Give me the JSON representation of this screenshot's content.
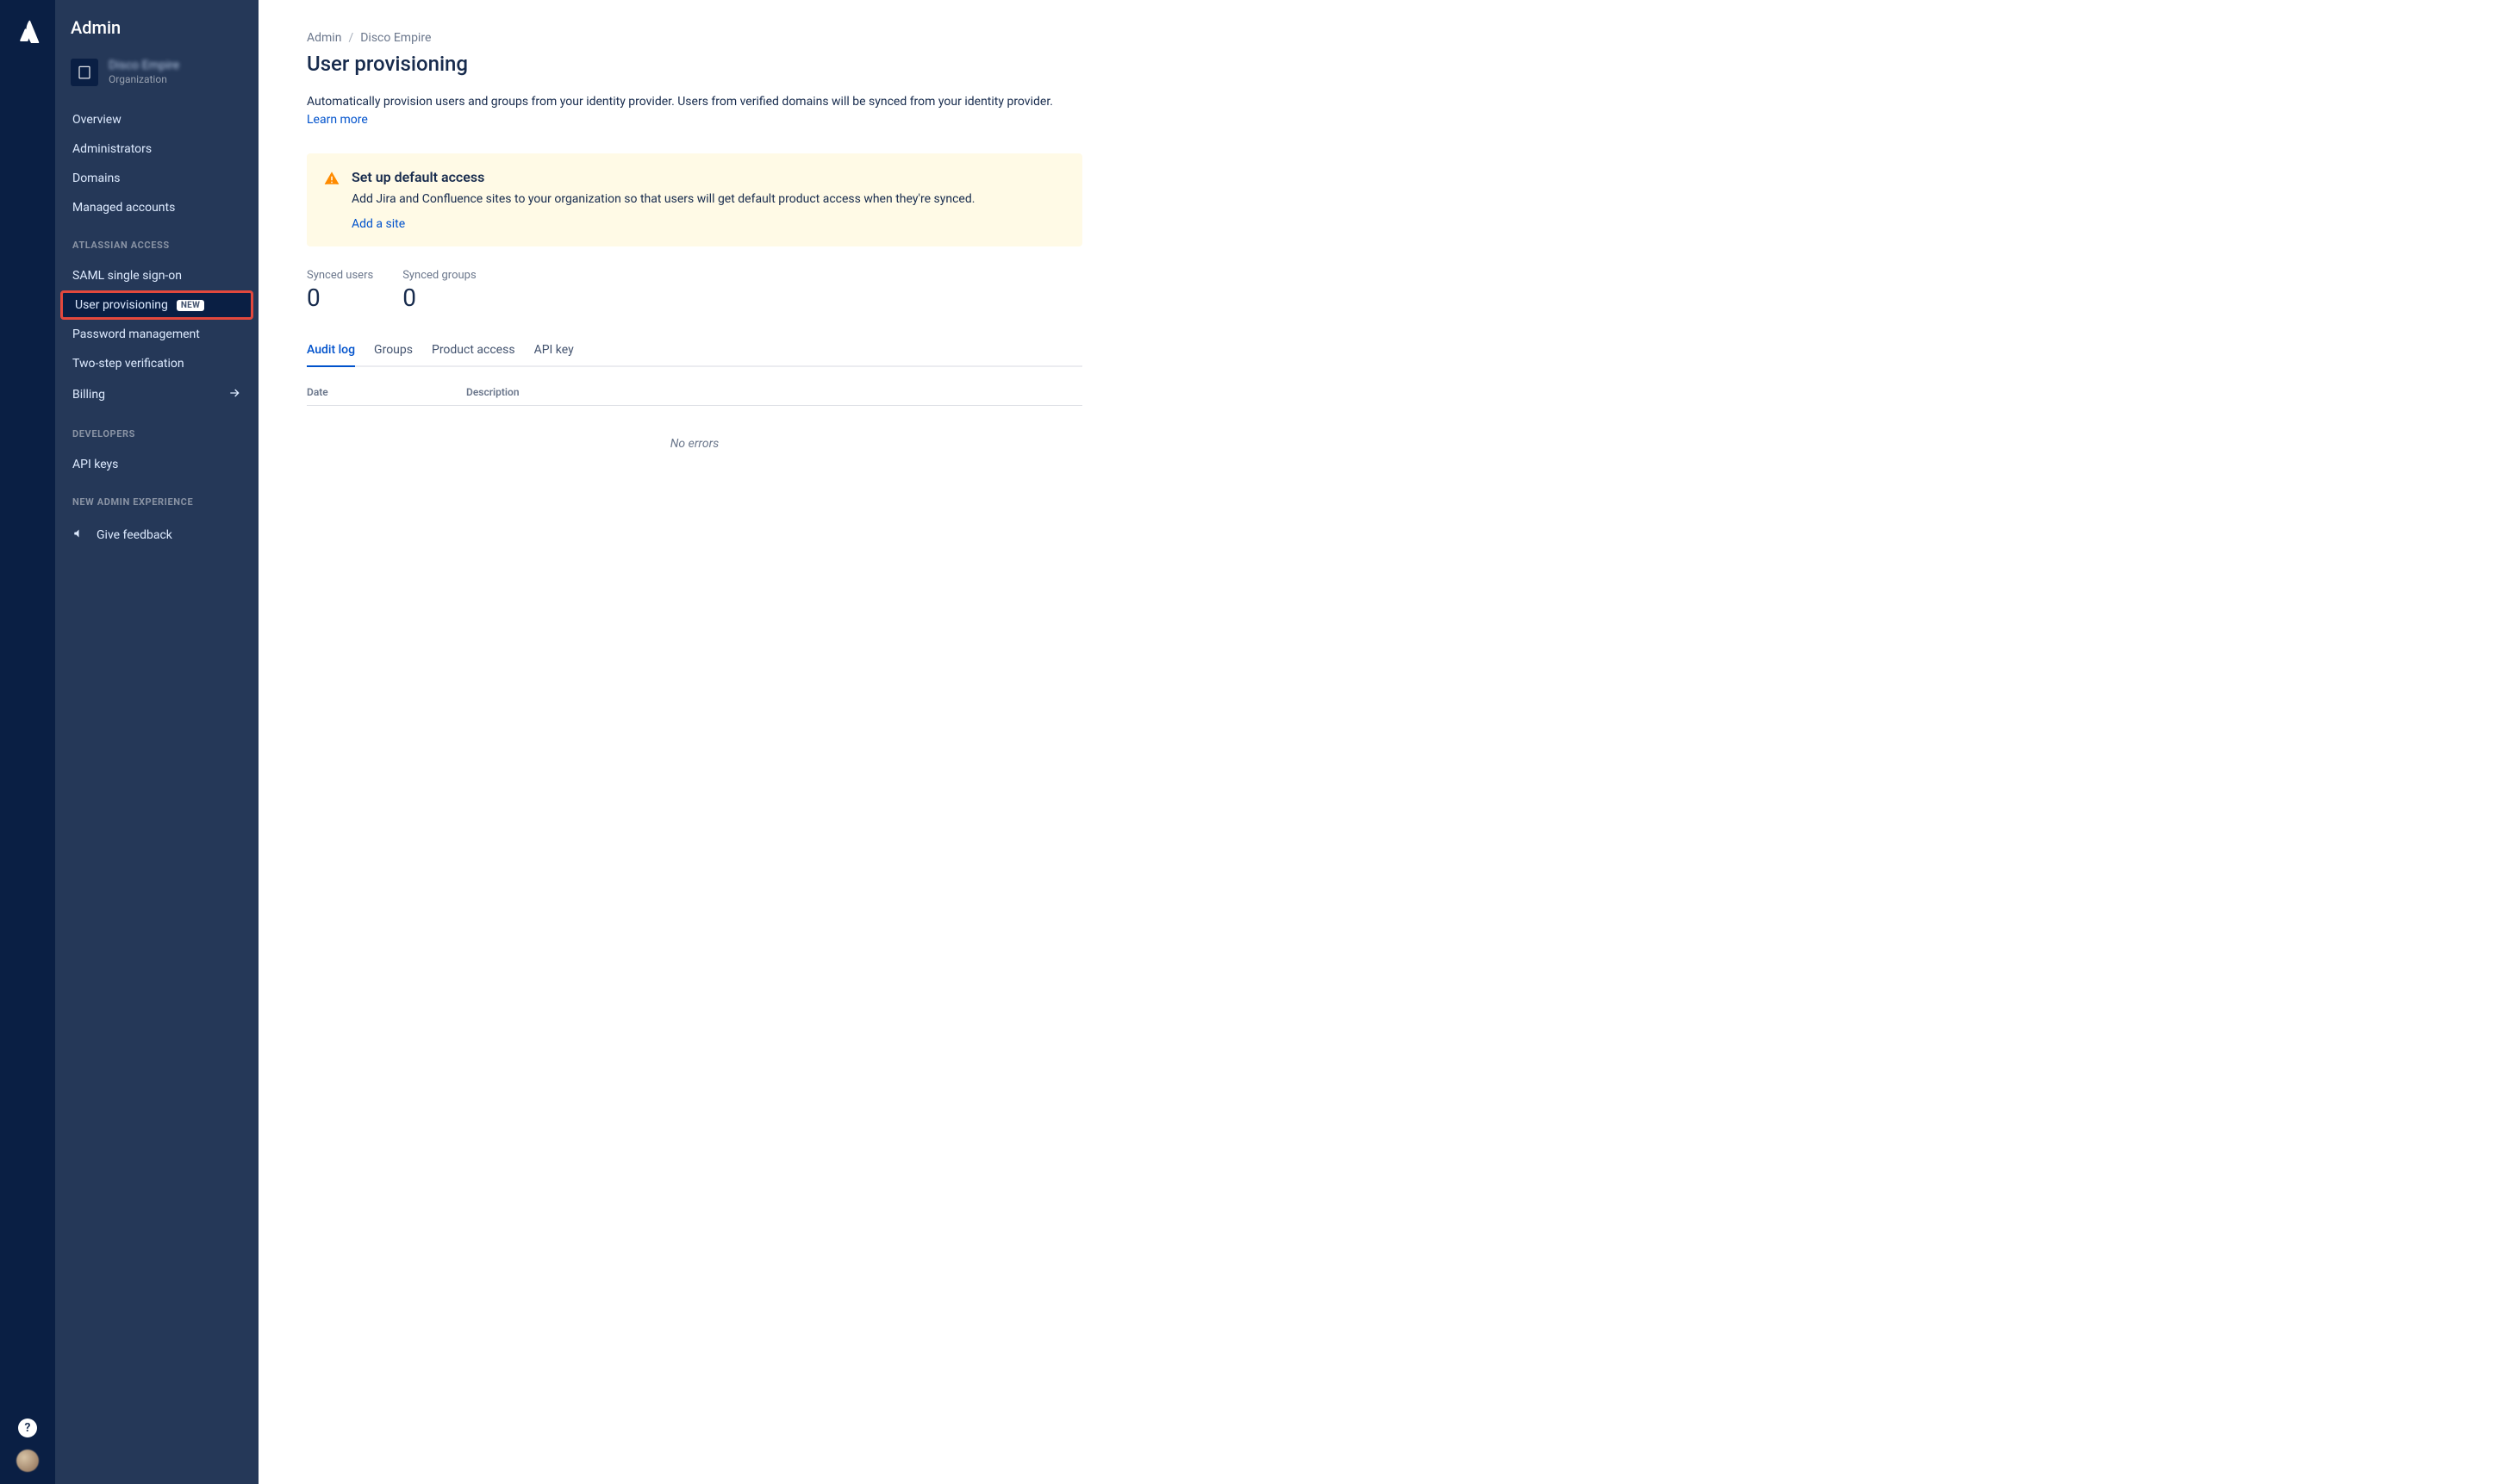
{
  "product_title": "Admin",
  "org": {
    "name": "Disco Empire",
    "subtitle": "Organization"
  },
  "nav": {
    "items_top": [
      {
        "label": "Overview"
      },
      {
        "label": "Administrators"
      },
      {
        "label": "Domains"
      },
      {
        "label": "Managed accounts"
      }
    ],
    "section_access": {
      "heading": "ATLASSIAN ACCESS"
    },
    "items_access": [
      {
        "label": "SAML single sign-on"
      },
      {
        "label": "User provisioning",
        "badge": "NEW"
      },
      {
        "label": "Password management"
      },
      {
        "label": "Two-step verification"
      },
      {
        "label": "Billing"
      }
    ],
    "section_dev": {
      "heading": "DEVELOPERS"
    },
    "items_dev": [
      {
        "label": "API keys"
      }
    ],
    "section_new": {
      "heading": "NEW ADMIN EXPERIENCE"
    },
    "items_new": [
      {
        "label": "Give feedback"
      }
    ]
  },
  "breadcrumb": {
    "root": "Admin",
    "current": "Disco Empire"
  },
  "page": {
    "title": "User provisioning",
    "intro": "Automatically provision users and groups from your identity provider. Users from verified domains will be synced from your identity provider.",
    "learn_more": "Learn more"
  },
  "banner": {
    "title": "Set up default access",
    "body": "Add Jira and Confluence sites to your organization so that users will get default product access when they're synced.",
    "link": "Add a site"
  },
  "stats": {
    "users_label": "Synced users",
    "users_value": "0",
    "groups_label": "Synced groups",
    "groups_value": "0"
  },
  "tabs": [
    {
      "label": "Audit log"
    },
    {
      "label": "Groups"
    },
    {
      "label": "Product access"
    },
    {
      "label": "API key"
    }
  ],
  "table": {
    "col_date": "Date",
    "col_desc": "Description",
    "empty": "No errors"
  }
}
